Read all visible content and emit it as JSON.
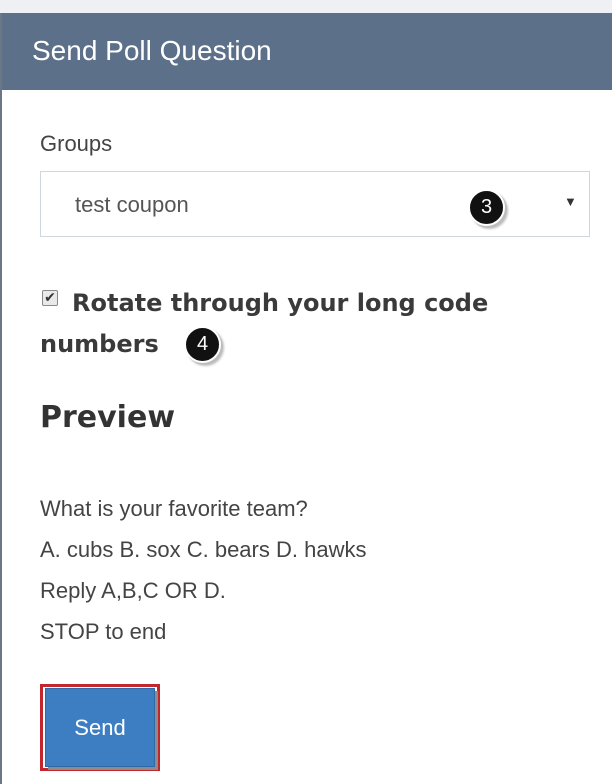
{
  "panel": {
    "title": "Send Poll Question"
  },
  "groups": {
    "label": "Groups",
    "selected": "test coupon",
    "arrow_icon": "triangle-down-icon"
  },
  "annotations": {
    "step3": "3",
    "step4": "4"
  },
  "rotate": {
    "checked": true,
    "label": "Rotate through your long code numbers"
  },
  "preview": {
    "heading": "Preview",
    "lines": [
      "What is your favorite team?",
      "A. cubs B. sox C. bears D. hawks",
      "Reply A,B,C OR D.",
      "STOP to end"
    ]
  },
  "actions": {
    "send_label": "Send"
  },
  "colors": {
    "header_bg": "#5c7089",
    "send_bg": "#3d7ec3",
    "highlight": "#c1272d"
  }
}
